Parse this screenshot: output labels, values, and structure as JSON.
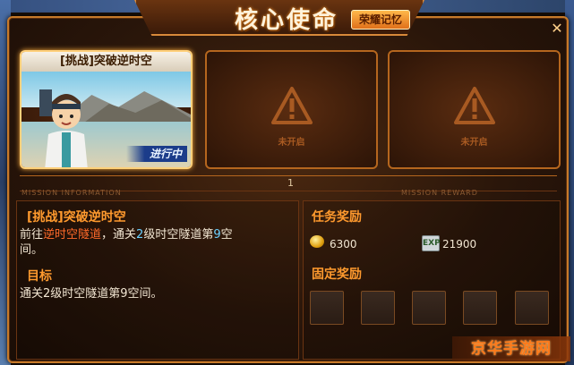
{
  "window": {
    "title": "核心使命",
    "honor_tab": "荣耀记忆",
    "close": "✕"
  },
  "missions": [
    {
      "title": "[挑战]突破逆时空",
      "status": "进行中"
    },
    {
      "locked_text": "未开启"
    },
    {
      "locked_text": "未开启"
    }
  ],
  "pager": {
    "page": "1"
  },
  "sections": {
    "info_label": "MISSION INFORMATION",
    "reward_label": "MISSION REWARD"
  },
  "mission_info": {
    "name": "[挑战]突破逆时空",
    "desc_1": "前往",
    "desc_place": "逆时空隧道",
    "desc_2": "，通关",
    "desc_level": "2",
    "desc_3": "级时空隧道第",
    "desc_room": "9",
    "desc_4": "空",
    "desc_5": "间。",
    "goal_label": "目标",
    "goal_text": "通关2级时空隧道第9空间。"
  },
  "rewards": {
    "task_label": "任务奖励",
    "coin_value": "6300",
    "exp_icon": "EXP",
    "exp_value": "21900",
    "fixed_label": "固定奖励"
  },
  "watermark": "京华手游网",
  "colors": {
    "accent": "#ff9a2e",
    "highlight_place": "#ff6a2a",
    "highlight_number": "#6ad0ff",
    "border": "#c77a2a"
  }
}
